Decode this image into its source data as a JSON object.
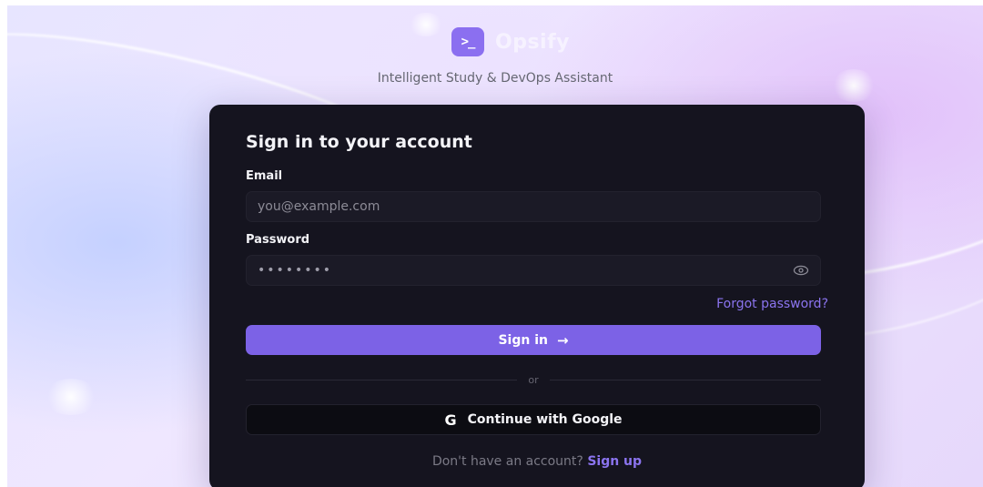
{
  "brand": {
    "logo_glyph": ">_",
    "name": "Opsify",
    "tagline": "Intelligent Study & DevOps Assistant",
    "accent_color": "#7c62e6"
  },
  "form": {
    "title": "Sign in to your account",
    "email_label": "Email",
    "email_placeholder": "you@example.com",
    "password_label": "Password",
    "password_value": "••••••••",
    "password_toggle_icon": "eye-icon",
    "forgot_link": "Forgot password?",
    "signin_label": "Sign in",
    "signin_icon": "arrow-right-icon",
    "divider_text": "or",
    "google_label": "Continue with Google",
    "google_icon": "google-icon",
    "signup_prompt": "Don't have an account?",
    "signup_link": "Sign up"
  }
}
